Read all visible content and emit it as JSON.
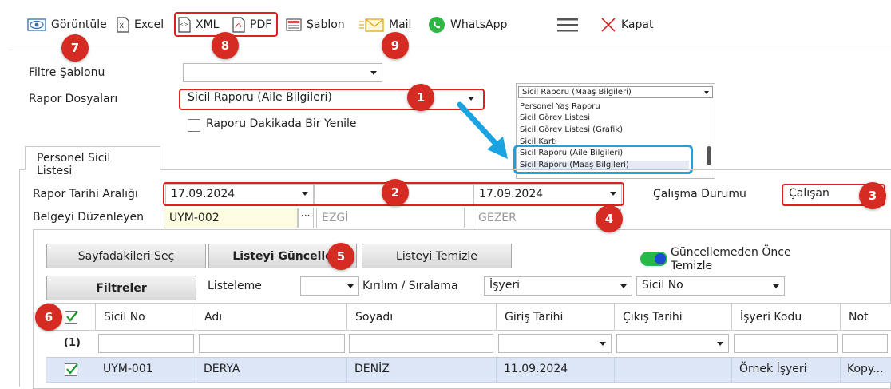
{
  "toolbar": {
    "view": "Görüntüle",
    "excel": "Excel",
    "xml": "XML",
    "pdf": "PDF",
    "template": "Şablon",
    "mail": "Mail",
    "whatsapp": "WhatsApp",
    "close": "Kapat"
  },
  "badges": [
    "1",
    "2",
    "3",
    "4",
    "5",
    "6",
    "7",
    "8",
    "9"
  ],
  "form": {
    "filter_template_label": "Filtre Şablonu",
    "filter_template_value": "",
    "report_files_label": "Rapor Dosyaları",
    "report_files_value": "Sicil Raporu (Aile Bilgileri)",
    "refresh_label": "Raporu Dakikada Bir Yenile"
  },
  "popup": {
    "selected": "Sicil Raporu (Maaş Bilgileri)",
    "items": [
      "Personel Yaş Raporu",
      "Sicil Görev Listesi",
      "Sicil Görev Listesi (Grafik)",
      "Sicil Kartı",
      "Sicil Raporu (Aile Bilgileri)",
      "Sicil Raporu (Maaş Bilgileri)"
    ]
  },
  "tab": {
    "label": "Personel Sicil Listesi"
  },
  "report": {
    "date_range_label": "Rapor Tarihi Aralığı",
    "date_from": "17.09.2024",
    "date_to": "17.09.2024",
    "work_status_label": "Çalışma Durumu",
    "work_status_value": "Çalışan",
    "issuer_label": "Belgeyi Düzenleyen",
    "issuer_code": "UYM-002",
    "issuer_first": "EZGİ",
    "issuer_last": "GEZER"
  },
  "actions": {
    "select_page": "Sayfadakileri Seç",
    "update_list": "Listeyi Güncelle",
    "clear_list": "Listeyi Temizle",
    "clear_before_update": "Güncellemeden Önce",
    "clear_before_update_2": "Temizle",
    "filters": "Filtreler",
    "listing_label": "Listeleme",
    "listing_value": "",
    "breakdown_label": "Kırılım / Sıralama",
    "breakdown_value": "İşyeri",
    "sort_value": "Sicil No"
  },
  "grid": {
    "columns": [
      "Sicil No",
      "Adı",
      "Soyadı",
      "Giriş Tarihi",
      "Çıkış Tarihi",
      "İşyeri Kodu",
      "Not"
    ],
    "count": "(1)",
    "rows": [
      {
        "sicil_no": "UYM-001",
        "adi": "DERYA",
        "soyadi": "DENİZ",
        "giris": "11.09.2024",
        "cikis": "",
        "isyeri": "Örnek İşyeri",
        "not": "Kopy..."
      }
    ]
  },
  "colors": {
    "accent_red": "#d62b22",
    "row_highlight": "#dce6f7",
    "callout_blue": "#1aa3e0"
  }
}
